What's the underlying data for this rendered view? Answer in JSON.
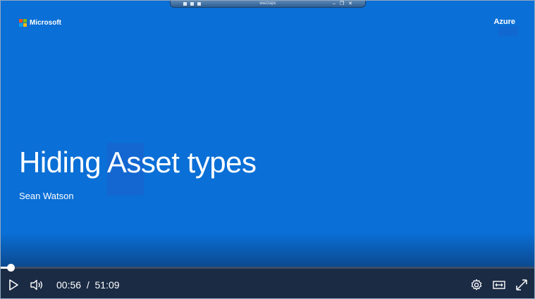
{
  "remote_bar": {
    "title": "wazzapc"
  },
  "slide": {
    "logo_text": "Microsoft",
    "corner_label": "Azure",
    "title": "Hiding Asset types",
    "presenter": "Sean Watson",
    "background_color": "#0a6fd6"
  },
  "player": {
    "current_time": "00:56",
    "separator": "/",
    "duration": "51:09",
    "progress_fraction": 0.0183,
    "icons": {
      "play": "play-icon",
      "volume": "volume-icon",
      "settings": "gear-icon",
      "theater": "theater-mode-icon",
      "fullscreen": "fullscreen-icon"
    }
  },
  "colors": {
    "control_bar": "#1b2b44",
    "logo": [
      "#f25022",
      "#7fba00",
      "#00a4ef",
      "#ffb900"
    ]
  }
}
